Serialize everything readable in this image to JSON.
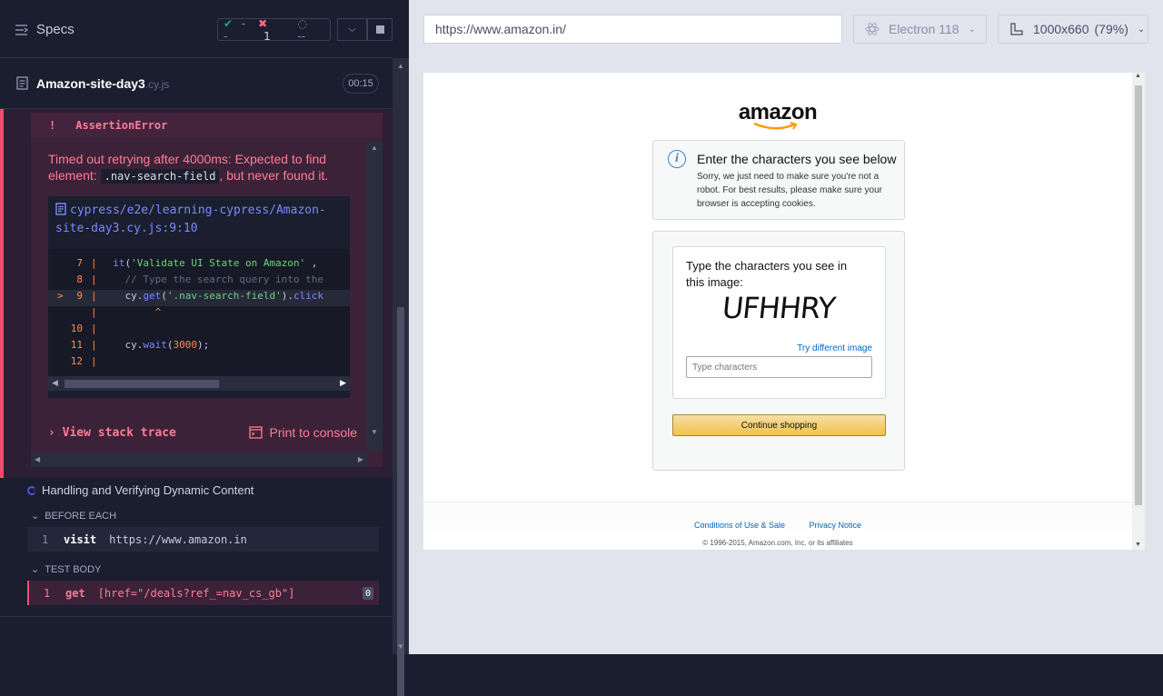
{
  "header": {
    "specs_label": "Specs",
    "passed": "--",
    "failed": "1",
    "pending": "--"
  },
  "spec": {
    "name": "Amazon-site-day3",
    "ext": ".cy.js",
    "duration": "00:15"
  },
  "error": {
    "icon": "!",
    "title": "AssertionError",
    "msg_before": "Timed out retrying after 4000ms: Expected to find element: ",
    "msg_code": ".nav-search-field",
    "msg_after": ", but never found it.",
    "file_path": "cypress/e2e/learning-cypress/Amazon-site-day3.cy.js:9:10",
    "code_lines": [
      {
        "num": "7",
        "marker": "",
        "code": "  it('Validate UI State on Amazon' ,"
      },
      {
        "num": "8",
        "marker": "",
        "code": "    // Type the search query into the"
      },
      {
        "num": "9",
        "marker": ">",
        "code": "    cy.get('.nav-search-field').click"
      },
      {
        "num": "",
        "marker": "",
        "code": "         ^"
      },
      {
        "num": "10",
        "marker": "",
        "code": ""
      },
      {
        "num": "11",
        "marker": "",
        "code": "    cy.wait(3000);"
      },
      {
        "num": "12",
        "marker": "",
        "code": ""
      }
    ],
    "view_stack": "View stack trace",
    "print_console": "Print to console"
  },
  "test2": {
    "title": "Handling and Verifying Dynamic Content",
    "before_each": "BEFORE EACH",
    "test_body": "TEST BODY",
    "cmd1_idx": "1",
    "cmd1_name": "visit",
    "cmd1_arg": "https://www.amazon.in",
    "cmd2_idx": "1",
    "cmd2_name": "get",
    "cmd2_arg": "[href=\"/deals?ref_=nav_cs_gb\"]",
    "cmd2_badge": "0"
  },
  "browser": {
    "url": "https://www.amazon.in/",
    "engine": "Electron 118",
    "viewport": "1000x660",
    "zoom": "(79%)"
  },
  "amazon": {
    "logo": "amazon",
    "info_title": "Enter the characters you see below",
    "info_text": "Sorry, we just need to make sure you're not a robot. For best results, please make sure your browser is accepting cookies.",
    "cap_title": "Type the characters you see in this image:",
    "captcha": "UFHHRY",
    "try_different": "Try different image",
    "input_placeholder": "Type characters",
    "continue": "Continue shopping",
    "footer_conditions": "Conditions of Use & Sale",
    "footer_privacy": "Privacy Notice",
    "copyright": "© 1996-2015, Amazon.com, Inc. or its affiliates"
  },
  "colors": {
    "accent_fail": "#f04d6c",
    "accent_pass": "#1fa971",
    "link": "#7a89ff"
  }
}
